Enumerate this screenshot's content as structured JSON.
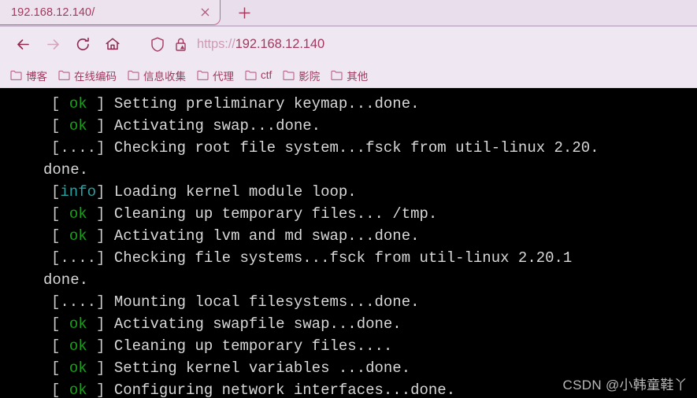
{
  "browser": {
    "tab": {
      "title": "192.168.12.140/",
      "close_icon": "close-icon"
    },
    "newtab_label": "+",
    "nav": {
      "back_icon": "back-arrow-icon",
      "forward_icon": "forward-arrow-icon",
      "reload_icon": "reload-icon",
      "home_icon": "home-icon",
      "shield_icon": "shield-icon",
      "lock_warning_icon": "lock-warning-icon"
    },
    "url": {
      "scheme": "https://",
      "host": "192.168.12.140",
      "full": "https://192.168.12.140"
    },
    "bookmarks": [
      {
        "label": "博客",
        "icon": "folder-icon"
      },
      {
        "label": "在线编码",
        "icon": "folder-icon"
      },
      {
        "label": "信息收集",
        "icon": "folder-icon"
      },
      {
        "label": "代理",
        "icon": "folder-icon"
      },
      {
        "label": "ctf",
        "icon": "folder-icon"
      },
      {
        "label": "影院",
        "icon": "folder-icon"
      },
      {
        "label": "其他",
        "icon": "folder-icon"
      }
    ]
  },
  "terminal": {
    "background": "#000000",
    "text_color": "#d8d8d8",
    "ok_color": "#17a117",
    "info_color": "#2aa0a0",
    "lines": [
      {
        "status": "ok",
        "open": "[ ",
        "tag": "ok",
        "close": " ] ",
        "text": "Setting preliminary keymap...done.",
        "indent": true
      },
      {
        "status": "ok",
        "open": "[ ",
        "tag": "ok",
        "close": " ] ",
        "text": "Activating swap...done.",
        "indent": true
      },
      {
        "status": "wait",
        "open": "[",
        "tag": "....",
        "close": "] ",
        "text": "Checking root file system...fsck from util-linux 2.20.",
        "indent": true
      },
      {
        "status": "cont",
        "open": "",
        "tag": "",
        "close": "",
        "text": "done.",
        "indent": false
      },
      {
        "status": "info",
        "open": "[",
        "tag": "info",
        "close": "] ",
        "text": "Loading kernel module loop.",
        "indent": true
      },
      {
        "status": "ok",
        "open": "[ ",
        "tag": "ok",
        "close": " ] ",
        "text": "Cleaning up temporary files... /tmp.",
        "indent": true
      },
      {
        "status": "ok",
        "open": "[ ",
        "tag": "ok",
        "close": " ] ",
        "text": "Activating lvm and md swap...done.",
        "indent": true
      },
      {
        "status": "wait",
        "open": "[",
        "tag": "....",
        "close": "] ",
        "text": "Checking file systems...fsck from util-linux 2.20.1",
        "indent": true
      },
      {
        "status": "cont",
        "open": "",
        "tag": "",
        "close": "",
        "text": "done.",
        "indent": false
      },
      {
        "status": "wait",
        "open": "[",
        "tag": "....",
        "close": "] ",
        "text": "Mounting local filesystems...done.",
        "indent": true
      },
      {
        "status": "ok",
        "open": "[ ",
        "tag": "ok",
        "close": " ] ",
        "text": "Activating swapfile swap...done.",
        "indent": true
      },
      {
        "status": "ok",
        "open": "[ ",
        "tag": "ok",
        "close": " ] ",
        "text": "Cleaning up temporary files....",
        "indent": true
      },
      {
        "status": "ok",
        "open": "[ ",
        "tag": "ok",
        "close": " ] ",
        "text": "Setting kernel variables ...done.",
        "indent": true
      },
      {
        "status": "ok",
        "open": "[ ",
        "tag": "ok",
        "close": " ] ",
        "text": "Configuring network interfaces...done.",
        "indent": true
      }
    ]
  },
  "watermark": {
    "text": "CSDN @小韩童鞋丫"
  }
}
